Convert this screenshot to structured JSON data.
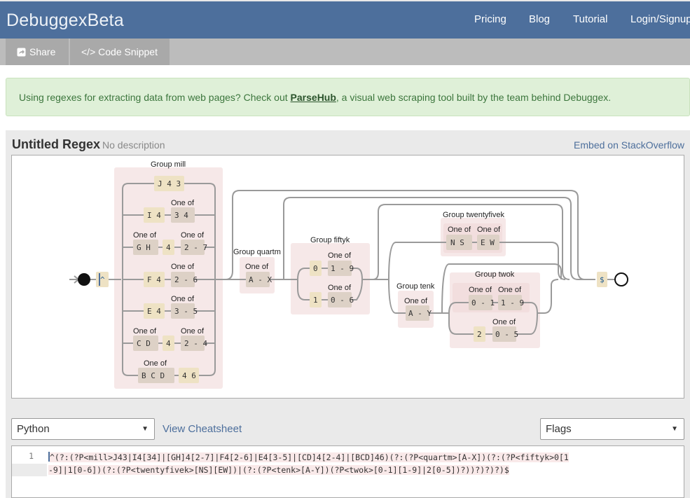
{
  "header": {
    "brand": "DebuggexBeta",
    "nav": [
      "Pricing",
      "Blog",
      "Tutorial",
      "Login/Signup"
    ]
  },
  "toolbar": {
    "share_label": "Share",
    "snippet_label": "</> Code Snippet"
  },
  "alert": {
    "text_before": "Using regexes for extracting data from web pages? Check out ",
    "link": "ParseHub",
    "text_after": ", a visual web scraping tool built by the team behind Debuggex."
  },
  "regex": {
    "title": "Untitled Regex",
    "description": "No description",
    "embed_link": "Embed on StackOverflow"
  },
  "diagram": {
    "group_labels": {
      "mill": "Group mill",
      "quartm": "Group quartm",
      "fiftyk": "Group fiftyk",
      "twentyfivek": "Group twentyfivek",
      "tenk": "Group tenk",
      "twok": "Group twok"
    },
    "one_of": "One of",
    "start_anchor": "^",
    "end_anchor": "$",
    "mill": {
      "opt1": "J 4 3",
      "opt2a": "I 4",
      "opt2b": "3 4",
      "opt3a": "G H",
      "opt3b": "4",
      "opt3c": "2 - 7",
      "opt4a": "F 4",
      "opt4b": "2 - 6",
      "opt5a": "E 4",
      "opt5b": "3 - 5",
      "opt6a": "C D",
      "opt6b": "4",
      "opt6c": "2 - 4",
      "opt7a": "B C D",
      "opt7b": "4 6"
    },
    "quartm": "A - X",
    "fiftyk": {
      "a1": "0",
      "a2": "1 - 9",
      "b1": "1",
      "b2": "0 - 6"
    },
    "twentyfivek": {
      "a": "N S",
      "b": "E W"
    },
    "tenk": "A - Y",
    "twok": {
      "a1": "0 - 1",
      "a2": "1 - 9",
      "b1": "2",
      "b2": "0 - 5"
    }
  },
  "language_select": "Python",
  "cheatsheet_link": "View Cheatsheet",
  "flags_select": "Flags",
  "editor": {
    "line1_number": "1",
    "line1": "^(?:(?P<mill>J43|I4[34]|[GH]4[2-7]|F4[2-6]|E4[3-5]|[CD]4[2-4]|[BCD]46)(?:(?P<quartm>[A-X])(?:(?P<fiftyk>0[1",
    "line2": "-9]|1[0-6])(?:(?P<twentyfivek>[NS][EW])|(?:(?P<tenk>[A-Y])(?P<twok>[0-1][1-9]|2[0-5])?))?)?)?)$"
  },
  "colors": {
    "header_bg": "#4d6f9c",
    "toolbar_bg": "#bcbcbc",
    "button_bg": "#a9a9a9",
    "alert_bg": "#dff0d8",
    "alert_text": "#3c763d",
    "link": "#4d6f9c",
    "group_bg": "#f6e8e8",
    "literal_bg": "#eee2c4",
    "charclass_bg": "#ddd1c6"
  },
  "icons": {
    "share": "share-icon",
    "caret": "caret-down-icon"
  }
}
